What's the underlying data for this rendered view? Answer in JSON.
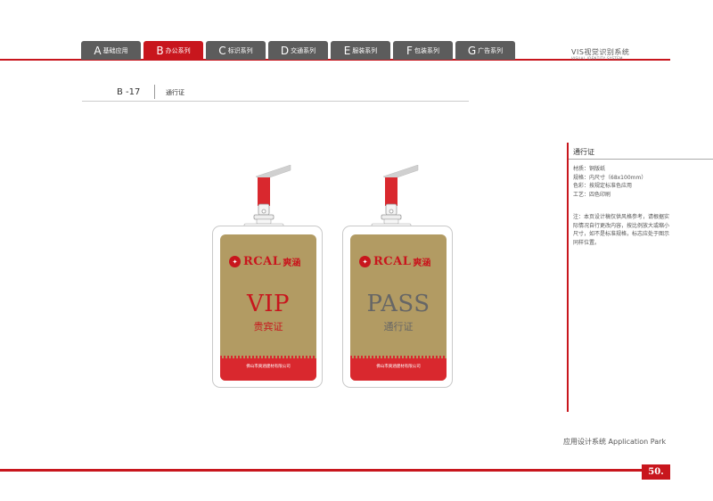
{
  "nav": {
    "tabs": [
      {
        "letter": "A",
        "label": "基础应用"
      },
      {
        "letter": "B",
        "label": "办公系列"
      },
      {
        "letter": "C",
        "label": "标识系列"
      },
      {
        "letter": "D",
        "label": "交通系列"
      },
      {
        "letter": "E",
        "label": "服装系列"
      },
      {
        "letter": "F",
        "label": "包装系列"
      },
      {
        "letter": "G",
        "label": "广告系列"
      }
    ],
    "active_tab": "B"
  },
  "system": {
    "title_cn": "VIS视觉识别系统",
    "title_en": "VISUAL IDENTITY SYSTEM"
  },
  "page": {
    "code": "B -17",
    "title": "通行证"
  },
  "info": {
    "title": "通行证",
    "specs": [
      "材质：铜版纸",
      "规格：内尺寸（68x100mm）",
      "色彩：按规定标准色应用",
      "工艺：四色印刷"
    ],
    "note": "注：本页设计稿仅供风格参考，请根据实际情况自行更改内容，按比例放大或缩小尺寸，如不是标准规格，标志应处于图示同样位置。"
  },
  "footer": {
    "text": "应用设计系统  Application  Park",
    "page_number": "50."
  },
  "badges": {
    "vip": {
      "brand": "RCAL",
      "brand_cn": "爽涵",
      "main": "VIP",
      "sub": "贵宾证",
      "company": "佛山市爽涵建材有限公司"
    },
    "pass": {
      "brand": "RCAL",
      "brand_cn": "爽涵",
      "main": "PASS",
      "sub": "通行证",
      "company": "佛山市爽涵建材有限公司"
    }
  },
  "colors": {
    "brand_red": "#c8161d",
    "tab_gray": "#5c5c5c",
    "insert_gold": "#b29b63"
  }
}
